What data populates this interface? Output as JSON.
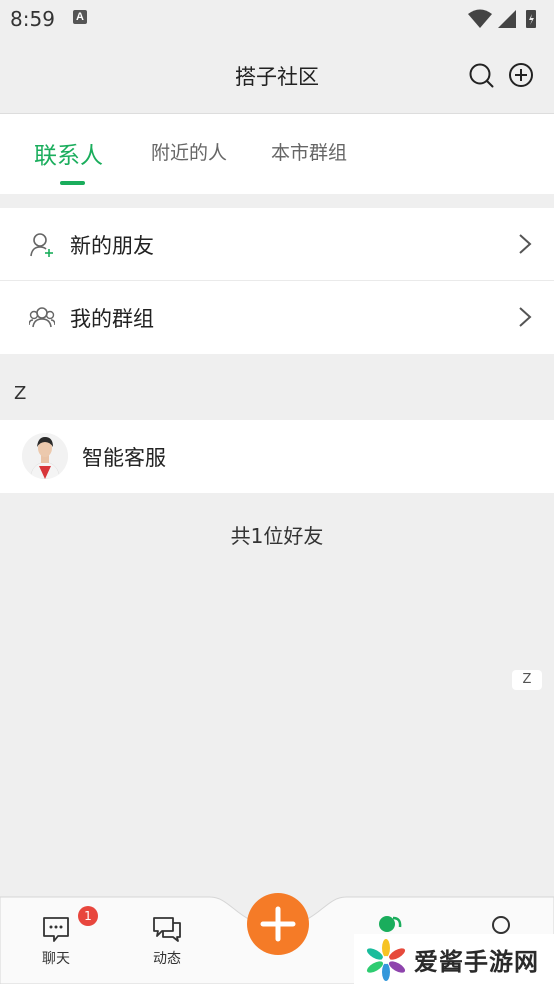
{
  "status_bar": {
    "time": "8:59",
    "notification_icon": "A"
  },
  "header": {
    "title": "搭子社区",
    "icons": [
      "search-icon",
      "add-circle-icon"
    ]
  },
  "tabs": [
    {
      "label": "联系人",
      "active": true
    },
    {
      "label": "附近的人",
      "active": false
    },
    {
      "label": "本市群组",
      "active": false
    }
  ],
  "menu": [
    {
      "label": "新的朋友",
      "icon": "add-friend-icon"
    },
    {
      "label": "我的群组",
      "icon": "group-icon"
    }
  ],
  "contacts": {
    "section_letter": "Z",
    "items": [
      {
        "name": "智能客服",
        "icon": "avatar"
      }
    ]
  },
  "friend_count": "共1位好友",
  "index_bar": {
    "letter": "Z"
  },
  "bottom_nav": {
    "items": [
      {
        "label": "聊天",
        "icon": "chat-icon",
        "badge": "1"
      },
      {
        "label": "动态",
        "icon": "moments-icon"
      }
    ],
    "fab_icon": "plus-icon"
  },
  "watermark": {
    "text": "爱酱手游网"
  },
  "colors": {
    "accent": "#1aad5c",
    "fab": "#f57b27",
    "badge": "#e8463d"
  }
}
